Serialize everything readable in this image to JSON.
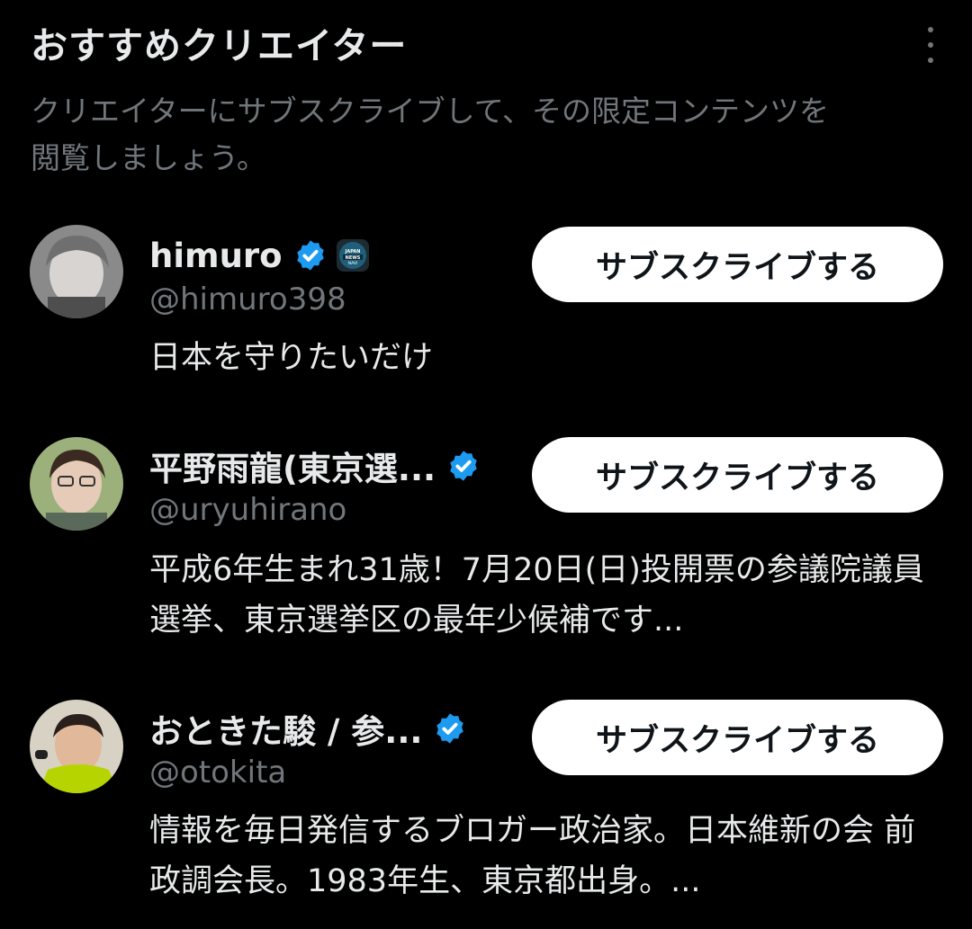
{
  "header": {
    "title": "おすすめクリエイター",
    "subtitle": "クリエイターにサブスクライブして、その限定コンテンツを閲覧しましょう。"
  },
  "creators": [
    {
      "name": "himuro",
      "handle": "@himuro398",
      "bio": "日本を守りたいだけ",
      "button": "サブスクライブする",
      "affiliate_badge": "JAPAN NEWS NAVI"
    },
    {
      "name": "平野雨龍(東京選...",
      "handle": "@uryuhirano",
      "bio": "平成6年生まれ31歳！7月20日(日)投開票の参議院議員選挙、東京選挙区の最年少候補です...",
      "button": "サブスクライブする"
    },
    {
      "name": "おときた駿 / 参...",
      "handle": "@otokita",
      "bio": "情報を毎日発信するブロガー政治家。日本維新の会 前政調会長。1983年生、東京都出身。...",
      "button": "サブスクライブする"
    }
  ],
  "colors": {
    "background": "#000000",
    "primary_text": "#e7e9ea",
    "secondary_text": "#71767b",
    "verified": "#1d9bf0",
    "button_bg": "#ffffff"
  },
  "icons": [
    "more-vertical-icon",
    "verified-badge-icon",
    "affiliate-badge-icon"
  ]
}
